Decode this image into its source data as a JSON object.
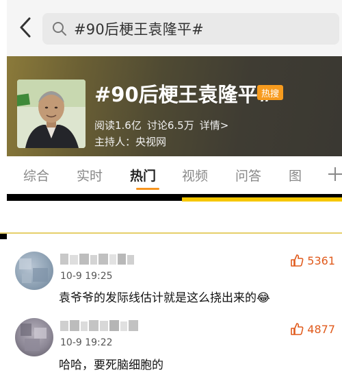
{
  "search": {
    "query": "#90后梗王袁隆平#"
  },
  "topic": {
    "title": "#90后梗王袁隆平#",
    "badge": "热搜",
    "read": "阅读1.6亿",
    "discuss": "讨论6.5万",
    "detail": "详情>",
    "host": "主持人：央视网"
  },
  "tabs": [
    {
      "label": "综合"
    },
    {
      "label": "实时"
    },
    {
      "label": "热门"
    },
    {
      "label": "视频"
    },
    {
      "label": "问答"
    },
    {
      "label": "图"
    }
  ],
  "active_tab": "热门",
  "colors": {
    "accent": "#f7941d",
    "like": "#e05a1c",
    "highlight": "#f6c700"
  },
  "comments": [
    {
      "time": "10-9 19:25",
      "likes": "5361",
      "text": "袁爷爷的发际线估计就是这么挠出来的",
      "emoji": "😂"
    },
    {
      "time": "10-9 19:22",
      "likes": "4877",
      "text": "哈哈，要死脑细胞的"
    }
  ],
  "icons": [
    "back-arrow-icon",
    "search-icon",
    "plus-icon",
    "thumbs-up-icon",
    "laughing-emoji-icon"
  ]
}
